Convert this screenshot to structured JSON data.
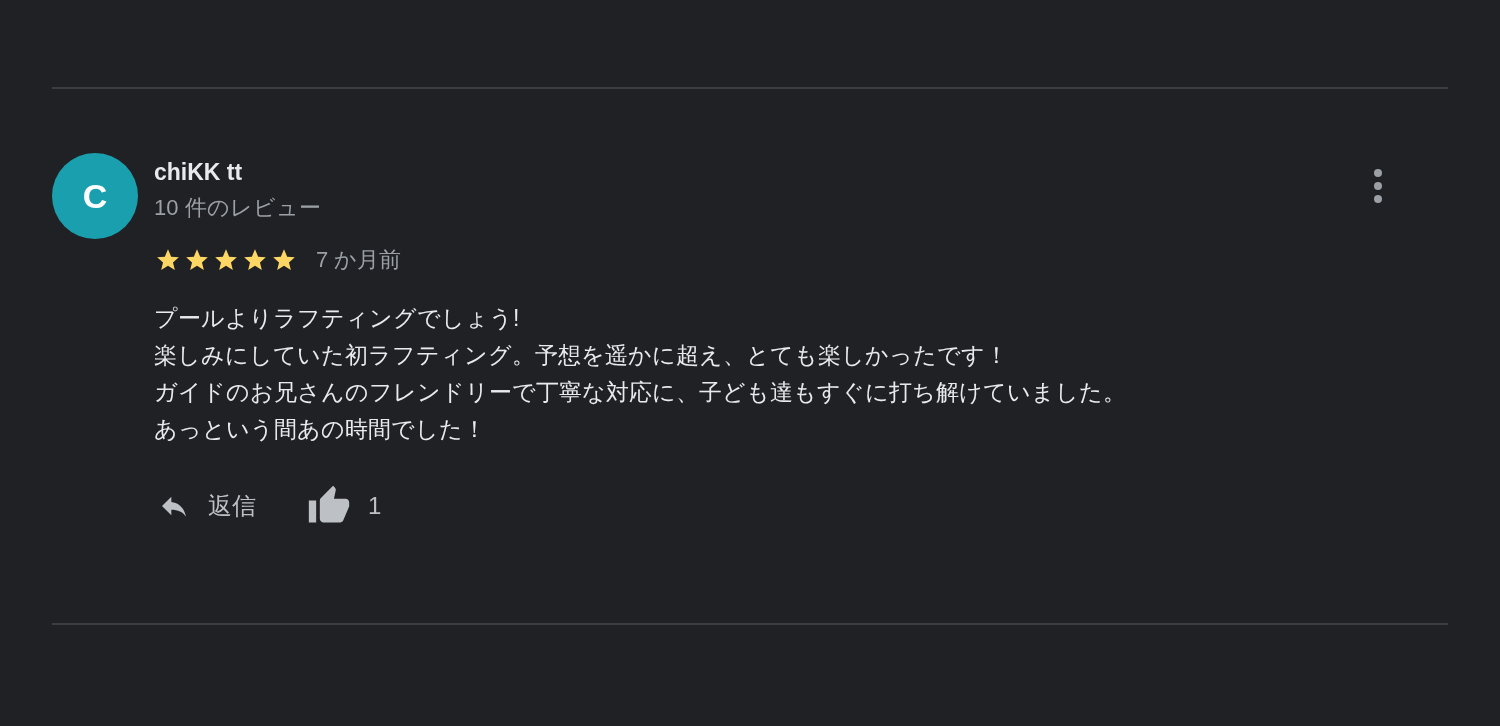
{
  "review": {
    "avatar_letter": "C",
    "author": "chiKK tt",
    "review_count": "10 件のレビュー",
    "stars": 5,
    "time": "7 か月前",
    "body": [
      "プールよりラフティングでしょう!",
      "楽しみにしていた初ラフティング。予想を遥かに超え、とても楽しかったです！",
      "ガイドのお兄さんのフレンドリーで丁寧な対応に、子ども達もすぐに打ち解けていました。",
      "あっという間あの時間でした！"
    ],
    "reply_label": "返信",
    "like_count": "1"
  }
}
